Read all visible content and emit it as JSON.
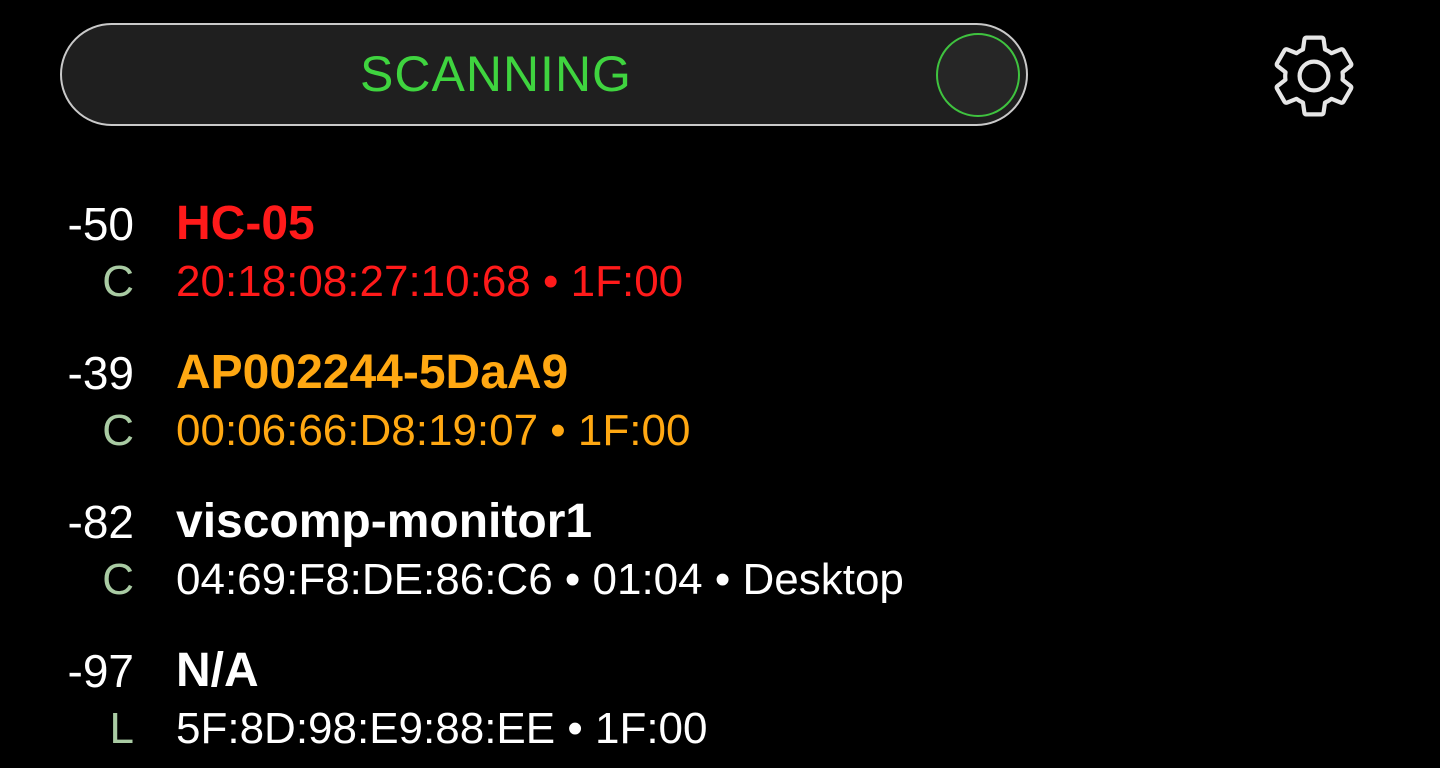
{
  "scan_button": {
    "label": "SCANNING",
    "label_color": "#3fd43f",
    "indicator_color": "#3fc33f"
  },
  "settings": {
    "icon": "gear-icon"
  },
  "devices": [
    {
      "rssi": "-50",
      "type": "C",
      "name": "HC-05",
      "info": "20:18:08:27:10:68 • 1F:00",
      "color": "#ff1a1a"
    },
    {
      "rssi": "-39",
      "type": "C",
      "name": "AP002244-5DaA9",
      "info": "00:06:66:D8:19:07 • 1F:00",
      "color": "#ffa812"
    },
    {
      "rssi": "-82",
      "type": "C",
      "name": "viscomp-monitor1",
      "info": "04:69:F8:DE:86:C6 • 01:04 • Desktop",
      "color": "#ffffff"
    },
    {
      "rssi": "-97",
      "type": "L",
      "name": "N/A",
      "info": "5F:8D:98:E9:88:EE • 1F:00",
      "color": "#ffffff"
    }
  ]
}
